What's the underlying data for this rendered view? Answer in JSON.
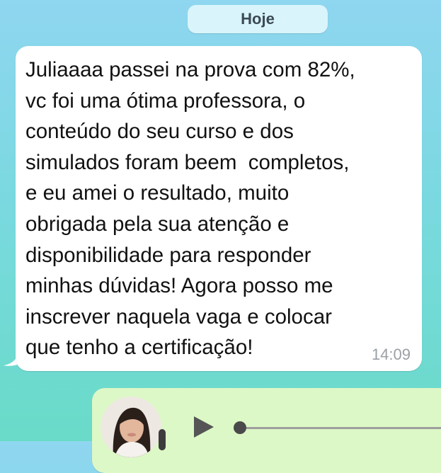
{
  "chat": {
    "date_label": "Hoje",
    "incoming_message": {
      "text": "Juliaaaa passei na prova com 82%,\nvc foi uma ótima professora, o\nconteúdo do seu curso e dos\nsimulados foram beem  completos,\ne eu amei o resultado, muito\nobrigada pela sua atenção e\ndisponibilidade para responder\nminhas dúvidas! Agora posso me\ninscrever naquela vaga e colocar\nque tenho a certificação!",
      "time": "14:09"
    },
    "outgoing_audio": {
      "avatar_icon": "user-avatar-icon",
      "play_icon": "play-icon",
      "progress": 0.0
    }
  },
  "colors": {
    "background_top": "#8fd6f0",
    "background_bottom": "#69dbc8",
    "incoming_bubble": "#ffffff",
    "outgoing_bubble": "#dcf8c6",
    "date_pill": "#d9f4fb"
  }
}
